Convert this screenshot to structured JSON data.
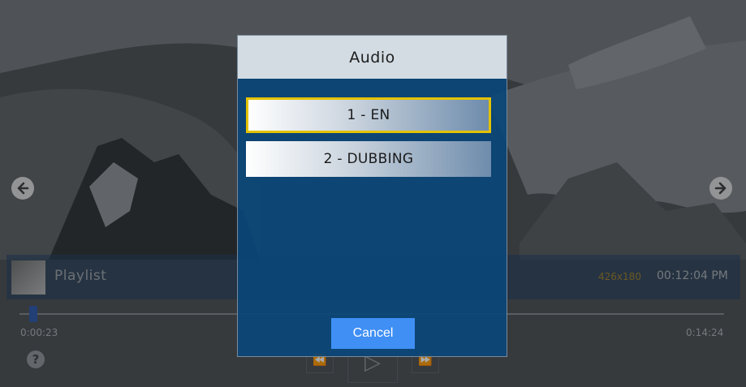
{
  "dialog": {
    "title": "Audio",
    "options": [
      {
        "label": "1 - EN",
        "selected": true
      },
      {
        "label": "2 - DUBBING",
        "selected": false
      }
    ],
    "cancel_label": "Cancel"
  },
  "player": {
    "playlist_label": "Playlist",
    "resolution": "426x180",
    "clock": "00:12:04 PM",
    "time_elapsed": "0:00:23",
    "time_total": "0:14:24",
    "help_label": "?",
    "rewind_glyph": "⏪",
    "play_glyph": "▷",
    "forward_glyph": "⏩",
    "progress": 0.02
  },
  "icons": {
    "prev": "arrow-left-icon",
    "next": "arrow-right-icon"
  },
  "colors": {
    "dialog_bg": "#0a4678",
    "header_bg": "#d3dce3",
    "focus_border": "#e3c200",
    "cancel_bg": "#3f8ff5",
    "resolution_text": "#9a7d2a"
  }
}
